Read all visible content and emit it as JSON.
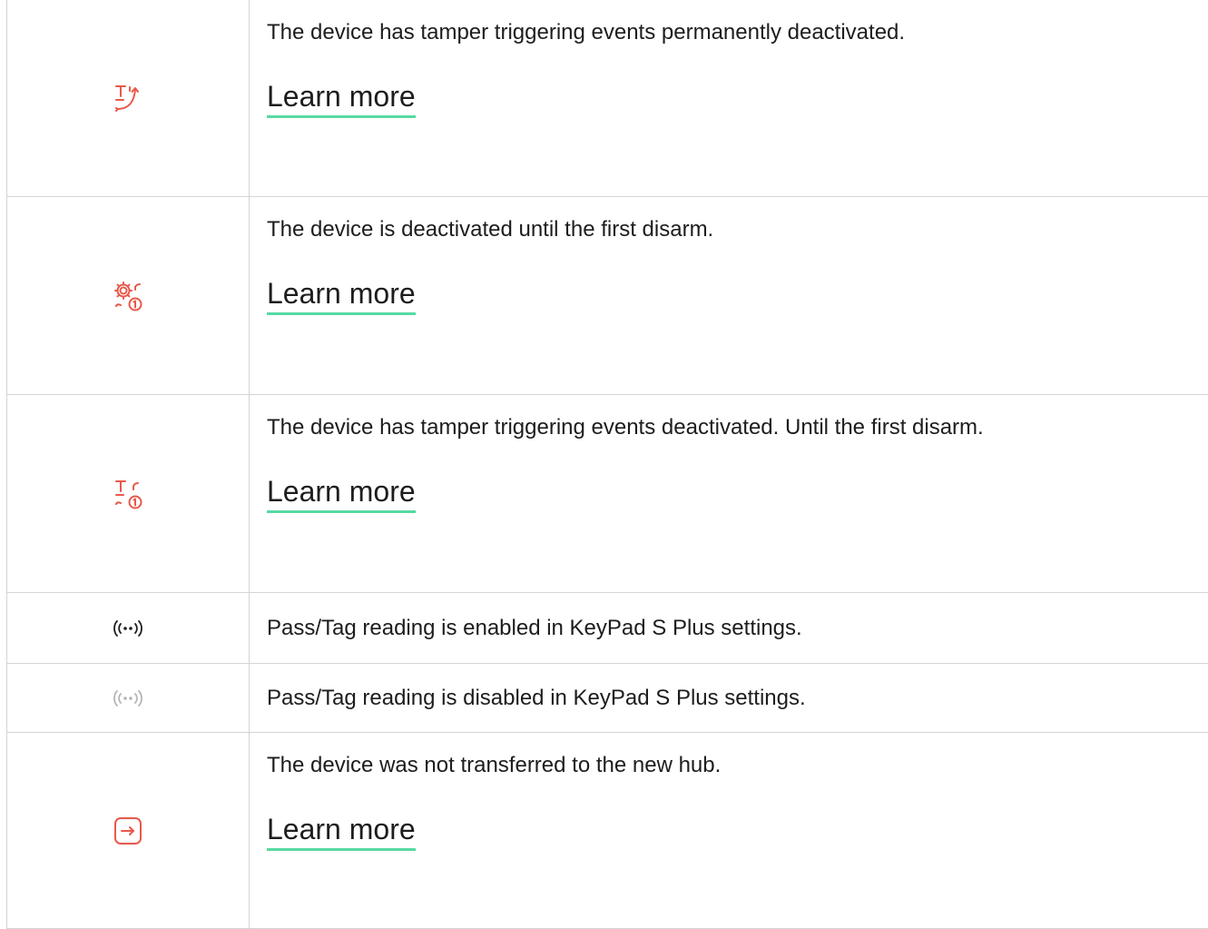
{
  "rows": [
    {
      "icon": "tamper-permanently-deactivated-icon",
      "text": "The device has tamper triggering events permanently deactivated.",
      "link": "Learn more"
    },
    {
      "icon": "deactivated-until-disarm-gear-icon",
      "text": "The device is deactivated until the first disarm.",
      "link": "Learn more"
    },
    {
      "icon": "tamper-deactivated-until-disarm-icon",
      "text": "The device has tamper triggering events deactivated. Until the first disarm.",
      "link": "Learn more"
    },
    {
      "icon": "pass-tag-enabled-icon",
      "text": "Pass/Tag reading is enabled in KeyPad S Plus settings."
    },
    {
      "icon": "pass-tag-disabled-icon",
      "text": "Pass/Tag reading is disabled in KeyPad S Plus settings."
    },
    {
      "icon": "not-transferred-icon",
      "text": "The device was not transferred to the new hub.",
      "link": "Learn more"
    }
  ],
  "colors": {
    "accent": "#e8594b",
    "link_underline": "#57d9a3",
    "border": "#d4d4d4",
    "icon_dark": "#1d1d1d",
    "icon_disabled": "#b5b5b5"
  }
}
